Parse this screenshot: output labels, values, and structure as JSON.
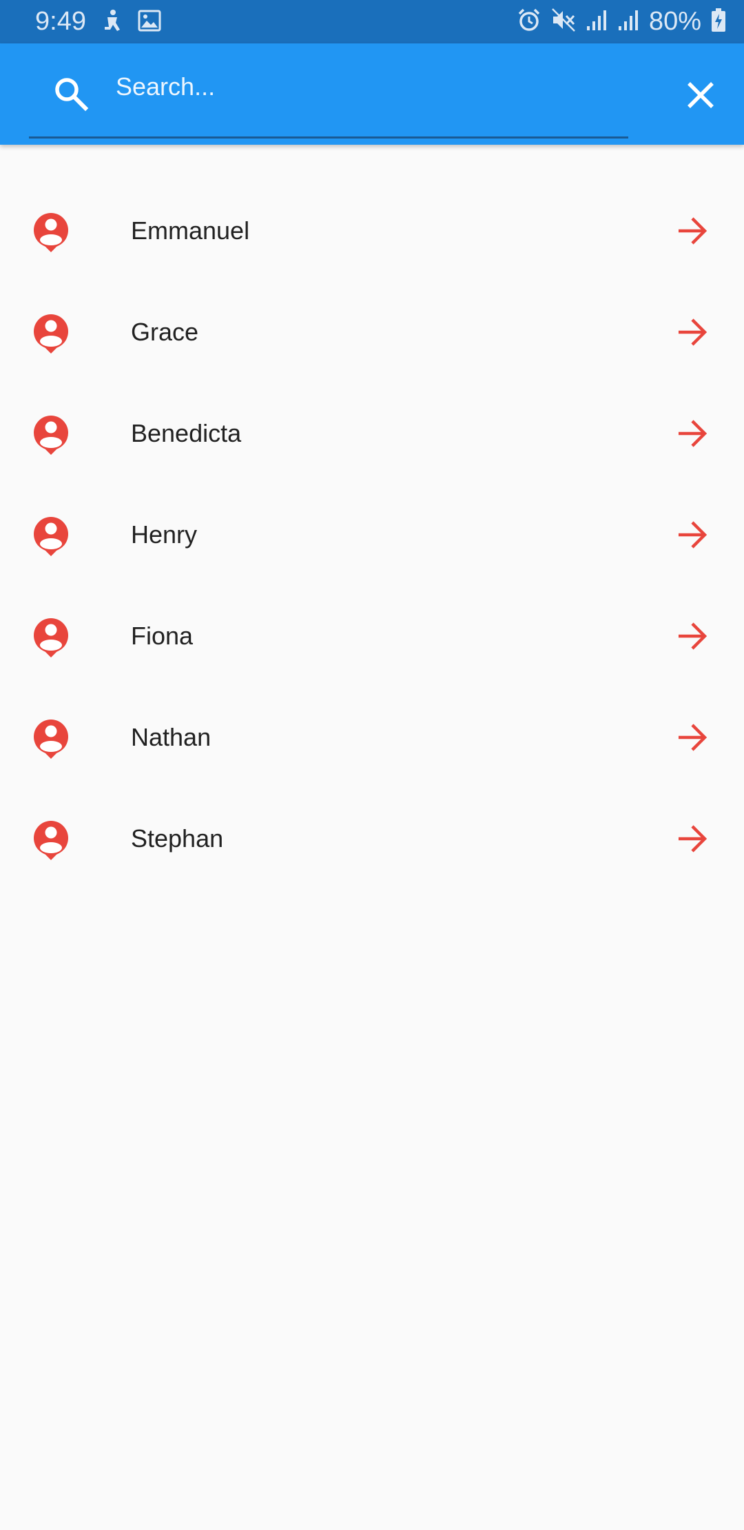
{
  "status_bar": {
    "time": "9:49",
    "battery": "80%",
    "left_icons": [
      "accessibility-icon",
      "image-icon"
    ],
    "right_icons": [
      "alarm-icon",
      "mute-icon",
      "signal-icon",
      "signal-icon",
      "battery-charging-icon"
    ]
  },
  "search": {
    "placeholder": "Search...",
    "value": ""
  },
  "colors": {
    "status_bar": "#1a6fbb",
    "app_bar": "#2196f3",
    "accent": "#e8453c",
    "background": "#fafafa",
    "text": "#212121"
  },
  "people": [
    {
      "name": "Emmanuel"
    },
    {
      "name": "Grace"
    },
    {
      "name": "Benedicta"
    },
    {
      "name": "Henry"
    },
    {
      "name": "Fiona"
    },
    {
      "name": "Nathan"
    },
    {
      "name": "Stephan"
    }
  ]
}
